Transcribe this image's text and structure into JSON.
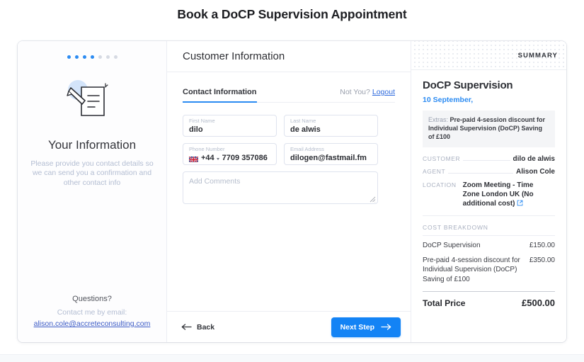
{
  "page": {
    "title": "Book a DoCP Supervision Appointment"
  },
  "progress": {
    "total_steps": 7,
    "completed_steps": 4
  },
  "left": {
    "icon": "document-pen-icon",
    "title": "Your Information",
    "description": "Please provide you contact details so we can send you a confirmation and other contact info",
    "questions_title": "Questions?",
    "contact_prompt": "Contact me by email:",
    "email": "alison.cole@accreteconsulting.com"
  },
  "center": {
    "header": "Customer Information",
    "tab_label": "Contact Information",
    "not_you_text": "Not You?",
    "logout_label": "Logout",
    "fields": [
      {
        "label": "First Name",
        "value": "dilo",
        "name": "first-name"
      },
      {
        "label": "Last Name",
        "value": "de alwis",
        "name": "last-name"
      },
      {
        "label": "Phone Number",
        "value": "7709 357086",
        "dial_code": "+44",
        "flag": "uk-flag-icon",
        "name": "phone-number"
      },
      {
        "label": "Email Address",
        "value": "dilogen@fastmail.fm",
        "name": "email-address"
      }
    ],
    "comments_placeholder": "Add Comments",
    "comments_value": "",
    "back_label": "Back",
    "next_label": "Next Step"
  },
  "summary": {
    "heading": "SUMMARY",
    "service_title": "DoCP Supervision",
    "date": "10 September,",
    "extras_label": "Extras:",
    "extras_value": "Pre-paid 4-session discount for Individual Supervision (DoCP) Saving of £100",
    "details": [
      {
        "key": "CUSTOMER",
        "value": "dilo de alwis"
      },
      {
        "key": "AGENT",
        "value": "Alison Cole"
      }
    ],
    "location_key": "LOCATION",
    "location_value": "Zoom Meeting - Time Zone London UK (No additional cost)",
    "location_link_icon": "external-link-icon",
    "cost_title": "COST BREAKDOWN",
    "cost_rows": [
      {
        "label": "DoCP Supervision",
        "amount": "£150.00"
      },
      {
        "label": "Pre-paid 4-session discount for Individual Supervision (DoCP) Saving of £100",
        "amount": "£350.00"
      }
    ],
    "total_label": "Total Price",
    "total_amount": "£500.00"
  },
  "colors": {
    "accent": "#1383f5",
    "link": "#2f6bdd",
    "muted": "#b3bdd2"
  }
}
